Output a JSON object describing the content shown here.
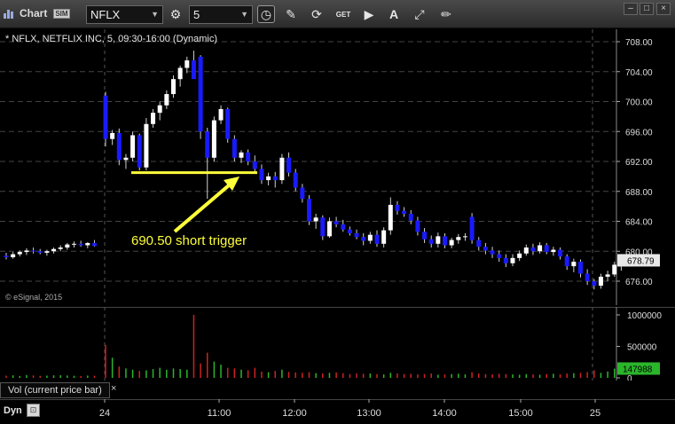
{
  "toolbar": {
    "title": "Chart",
    "sim_badge": "SIM",
    "symbol_value": "NFLX",
    "interval_value": "5",
    "icons": [
      "interval-settings-icon",
      "clock-icon",
      "pencil-icon",
      "link-icon",
      "get-icon",
      "play-icon",
      "text-tool-icon",
      "drawing-tool-icon"
    ]
  },
  "chart": {
    "title": "* NFLX, NETFLIX INC, 5, 09:30-16:00 (Dynamic)",
    "copyright": "© eSignal, 2015",
    "annotation": "690.50 short trigger",
    "last_price": "678.79",
    "last_volume": "147988",
    "volume_label": "Vol (current price bar)",
    "close_glyph": "×",
    "dyn_label": "Dyn",
    "colors": {
      "up": "#ffffff",
      "down": "#1a1aff",
      "annotation": "#ffff3a",
      "vol_up": "#2bb52b",
      "vol_down": "#cc2222"
    }
  },
  "chart_data": {
    "type": "candlestick",
    "symbol": "NFLX",
    "interval": "5",
    "price_ylim": [
      674,
      709
    ],
    "price_ticks": [
      "708.00",
      "704.00",
      "700.00",
      "696.00",
      "692.00",
      "688.00",
      "684.00",
      "680.00",
      "676.00"
    ],
    "volume_ticks": [
      "1000000",
      "500000",
      "0"
    ],
    "time_ticks": [
      "24",
      "11:00",
      "12:00",
      "13:00",
      "14:00",
      "15:00",
      "25"
    ],
    "trigger_level": 690.5,
    "candles": [
      [
        679.4,
        679.8,
        678.9,
        679.2
      ],
      [
        679.2,
        679.9,
        679.0,
        679.6
      ],
      [
        679.6,
        680.1,
        679.3,
        679.9
      ],
      [
        679.9,
        680.4,
        679.5,
        680.1
      ],
      [
        680.1,
        680.5,
        679.7,
        680.0
      ],
      [
        680.0,
        680.3,
        679.6,
        679.8
      ],
      [
        679.8,
        680.2,
        679.4,
        680.0
      ],
      [
        680.0,
        680.5,
        679.7,
        680.3
      ],
      [
        680.3,
        680.8,
        680.0,
        680.5
      ],
      [
        680.5,
        681.1,
        680.2,
        680.9
      ],
      [
        680.9,
        681.3,
        680.5,
        681.0
      ],
      [
        681.0,
        681.4,
        680.6,
        680.8
      ],
      [
        680.8,
        681.2,
        680.4,
        681.1
      ],
      [
        681.1,
        681.5,
        680.6,
        680.7
      ],
      [
        700.8,
        701.3,
        694.0,
        695.0
      ],
      [
        695.0,
        696.2,
        694.2,
        695.8
      ],
      [
        695.8,
        696.4,
        691.5,
        692.2
      ],
      [
        692.2,
        693.0,
        691.0,
        692.5
      ],
      [
        692.5,
        696.0,
        692.0,
        695.5
      ],
      [
        695.5,
        695.7,
        690.8,
        691.2
      ],
      [
        691.2,
        697.8,
        690.8,
        697.0
      ],
      [
        697.0,
        699.0,
        696.5,
        698.5
      ],
      [
        698.5,
        700.0,
        697.5,
        699.5
      ],
      [
        699.5,
        701.5,
        699.0,
        701.0
      ],
      [
        701.0,
        703.5,
        700.5,
        703.0
      ],
      [
        703.0,
        704.8,
        702.0,
        704.5
      ],
      [
        704.5,
        706.0,
        703.8,
        705.5
      ],
      [
        705.5,
        706.8,
        704.5,
        703.0
      ],
      [
        706.0,
        706.2,
        695.0,
        696.0
      ],
      [
        696.0,
        696.5,
        687.0,
        692.5
      ],
      [
        692.5,
        698.0,
        692.0,
        697.5
      ],
      [
        697.5,
        699.5,
        697.0,
        699.0
      ],
      [
        699.0,
        699.2,
        694.5,
        695.0
      ],
      [
        695.0,
        695.5,
        692.0,
        692.5
      ],
      [
        692.5,
        693.5,
        691.8,
        693.2
      ],
      [
        693.2,
        693.6,
        691.5,
        692.0
      ],
      [
        692.0,
        692.8,
        690.5,
        691.0
      ],
      [
        691.0,
        691.6,
        689.0,
        689.5
      ],
      [
        689.5,
        690.5,
        688.8,
        690.0
      ],
      [
        690.0,
        690.6,
        688.5,
        689.5
      ],
      [
        689.5,
        693.0,
        689.0,
        692.5
      ],
      [
        692.5,
        693.2,
        690.0,
        690.5
      ],
      [
        690.5,
        691.0,
        688.0,
        688.5
      ],
      [
        688.5,
        689.0,
        686.5,
        687.0
      ],
      [
        687.0,
        687.5,
        683.5,
        684.0
      ],
      [
        684.0,
        685.0,
        683.0,
        684.5
      ],
      [
        684.5,
        684.8,
        681.5,
        682.0
      ],
      [
        682.0,
        684.5,
        681.8,
        684.0
      ],
      [
        684.0,
        684.6,
        683.2,
        683.6
      ],
      [
        683.6,
        684.2,
        682.6,
        682.9
      ],
      [
        682.9,
        683.3,
        682.1,
        682.4
      ],
      [
        682.4,
        682.9,
        681.6,
        681.9
      ],
      [
        681.9,
        682.4,
        680.8,
        681.4
      ],
      [
        681.4,
        682.6,
        681.0,
        682.2
      ],
      [
        682.2,
        682.8,
        680.6,
        681.0
      ],
      [
        681.0,
        683.2,
        680.5,
        682.8
      ],
      [
        682.8,
        687.2,
        682.2,
        686.2
      ],
      [
        686.2,
        686.7,
        684.9,
        685.4
      ],
      [
        685.4,
        685.9,
        684.6,
        685.0
      ],
      [
        685.0,
        685.5,
        683.6,
        684.1
      ],
      [
        684.1,
        684.6,
        682.1,
        682.6
      ],
      [
        682.6,
        683.1,
        681.1,
        681.6
      ],
      [
        681.6,
        682.1,
        680.5,
        681.0
      ],
      [
        681.0,
        682.5,
        680.5,
        682.0
      ],
      [
        682.0,
        682.4,
        680.4,
        680.8
      ],
      [
        680.8,
        681.8,
        680.4,
        681.5
      ],
      [
        681.5,
        682.3,
        681.0,
        681.9
      ],
      [
        681.9,
        682.4,
        681.4,
        682.0
      ],
      [
        684.6,
        685.1,
        681.0,
        681.5
      ],
      [
        681.5,
        681.9,
        680.1,
        680.6
      ],
      [
        680.6,
        681.1,
        679.6,
        680.1
      ],
      [
        680.1,
        680.6,
        679.1,
        679.6
      ],
      [
        679.6,
        680.1,
        678.6,
        679.1
      ],
      [
        679.1,
        679.6,
        677.9,
        678.4
      ],
      [
        678.4,
        679.6,
        678.0,
        679.1
      ],
      [
        679.1,
        680.1,
        678.7,
        679.7
      ],
      [
        679.7,
        680.9,
        679.4,
        680.5
      ],
      [
        680.5,
        681.0,
        679.5,
        680.0
      ],
      [
        680.0,
        681.2,
        679.7,
        680.8
      ],
      [
        680.8,
        681.1,
        679.6,
        679.9
      ],
      [
        679.9,
        680.6,
        679.4,
        680.2
      ],
      [
        680.2,
        680.5,
        678.9,
        679.3
      ],
      [
        679.3,
        679.6,
        677.5,
        678.0
      ],
      [
        678.0,
        679.0,
        677.2,
        678.6
      ],
      [
        678.6,
        678.9,
        676.5,
        677.0
      ],
      [
        677.0,
        677.6,
        675.5,
        676.0
      ],
      [
        676.0,
        676.3,
        674.9,
        675.4
      ],
      [
        675.4,
        677.0,
        675.0,
        676.6
      ],
      [
        676.6,
        677.4,
        676.0,
        676.9
      ],
      [
        676.9,
        678.6,
        676.6,
        678.2
      ],
      [
        678.2,
        678.9,
        677.4,
        678.79
      ]
    ],
    "volume": [
      35000,
      40000,
      30000,
      45000,
      38000,
      32000,
      36000,
      40000,
      42000,
      38000,
      33000,
      30000,
      36000,
      34000,
      520000,
      320000,
      180000,
      150000,
      130000,
      110000,
      120000,
      140000,
      160000,
      130000,
      150000,
      140000,
      130000,
      1000000,
      230000,
      400000,
      260000,
      210000,
      160000,
      150000,
      130000,
      120000,
      160000,
      100000,
      90000,
      110000,
      130000,
      95000,
      85000,
      80000,
      90000,
      75000,
      70000,
      80000,
      85000,
      75000,
      60000,
      70000,
      65000,
      70000,
      60000,
      55000,
      80000,
      70000,
      60000,
      65000,
      55000,
      60000,
      70000,
      50000,
      55000,
      60000,
      65000,
      55000,
      90000,
      70000,
      60000,
      55000,
      65000,
      60000,
      55000,
      50000,
      60000,
      55000,
      50000,
      60000,
      65000,
      55000,
      70000,
      75000,
      80000,
      90000,
      120000,
      80000,
      100000,
      147988
    ]
  }
}
